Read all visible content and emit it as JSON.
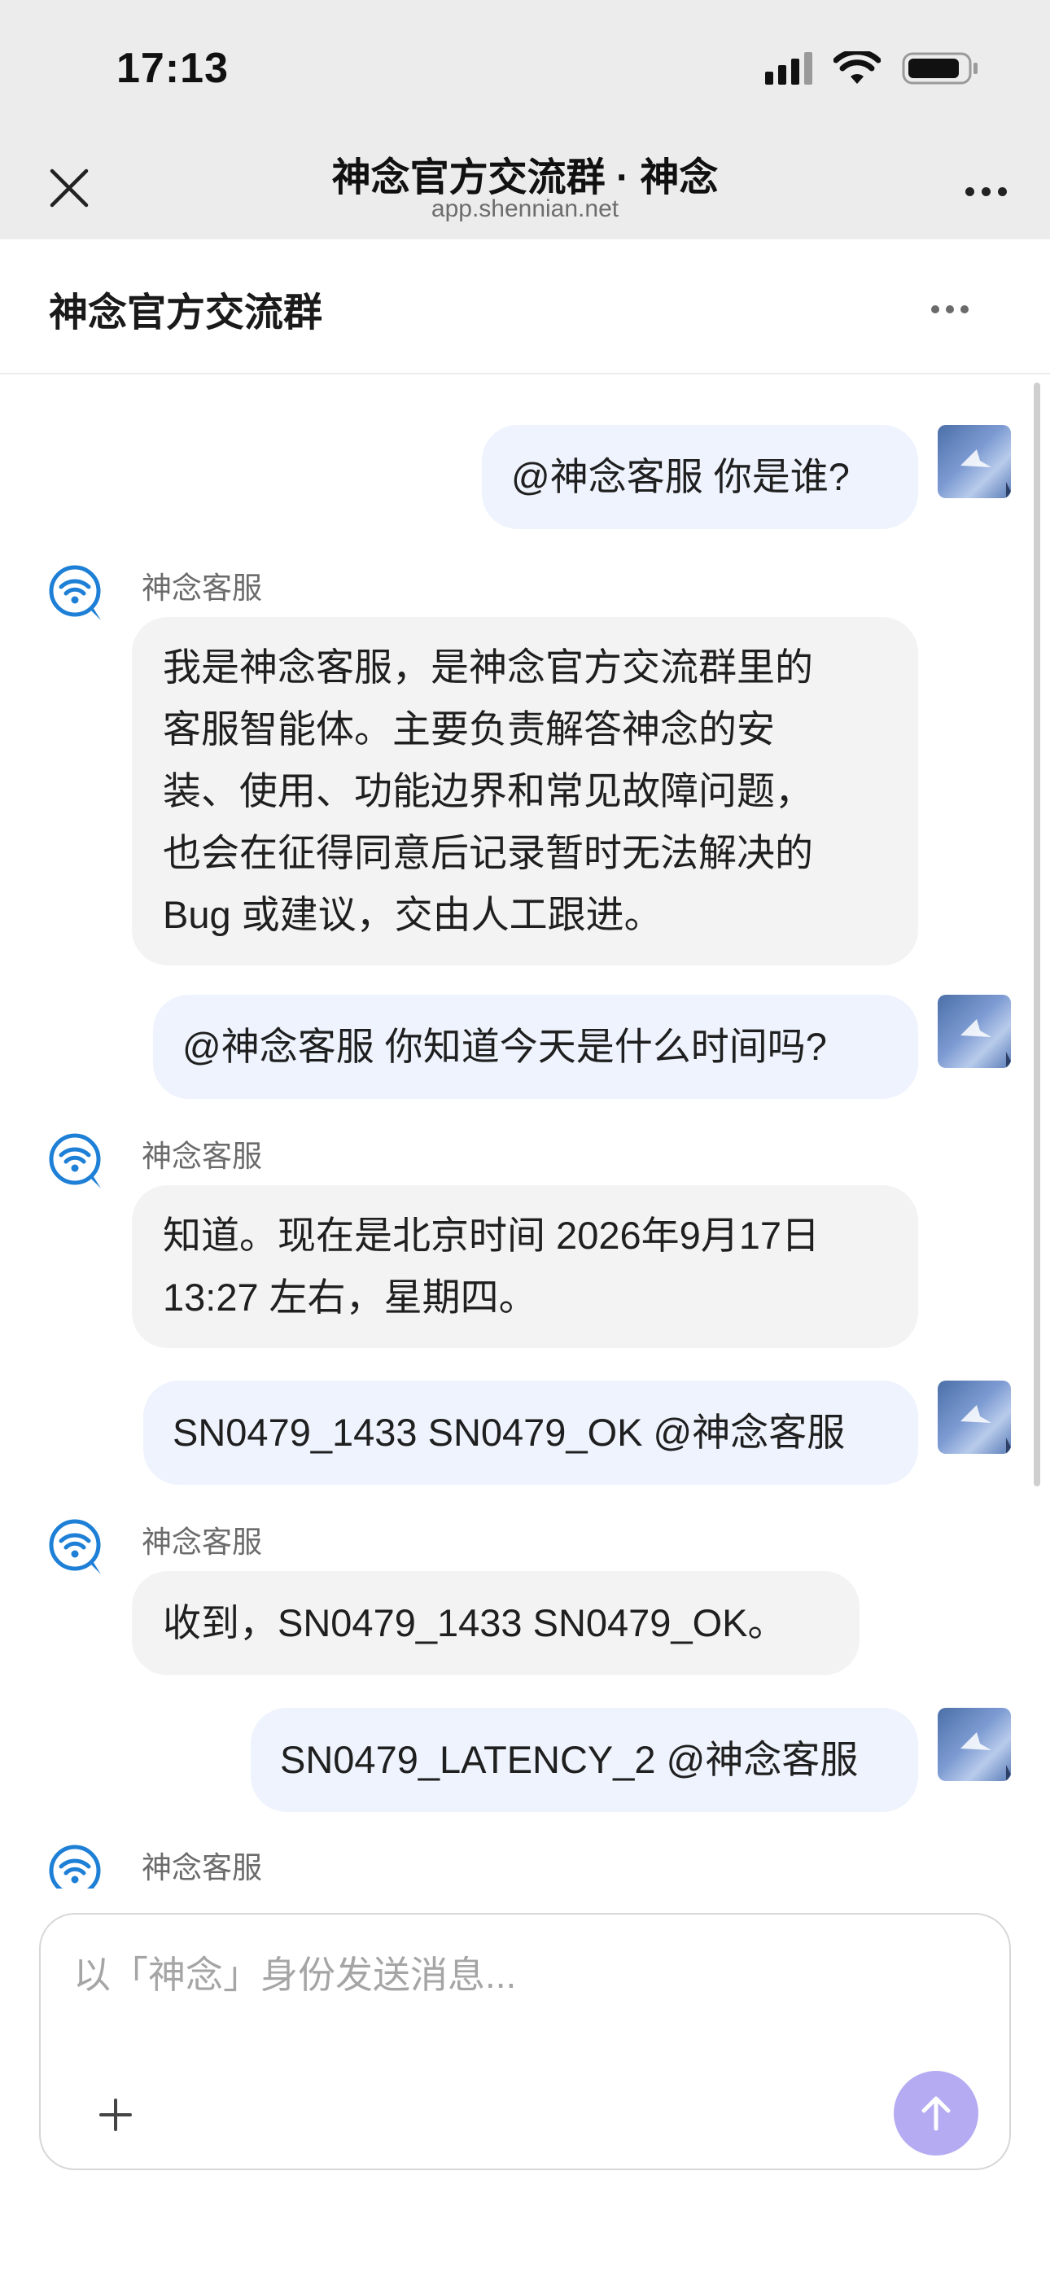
{
  "status_bar": {
    "time": "17:13"
  },
  "browser": {
    "title": "神念官方交流群 · 神念",
    "url": "app.shennian.net"
  },
  "chat": {
    "title": "神念官方交流群"
  },
  "messages": [
    {
      "role": "user",
      "text": "@神念客服 你是谁?"
    },
    {
      "role": "bot",
      "name": "神念客服",
      "lines": [
        "我是神念客服，是神念官方交流群里的",
        "客服智能体。主要负责解答神念的安",
        "装、使用、功能边界和常见故障问题，",
        "也会在征得同意后记录暂时无法解决的",
        "Bug 或建议，交由人工跟进。"
      ]
    },
    {
      "role": "user",
      "text": "@神念客服 你知道今天是什么时间吗?"
    },
    {
      "role": "bot",
      "name": "神念客服",
      "lines": [
        "知道。现在是北京时间 2026年9月17日",
        "13:27 左右，星期四。"
      ]
    },
    {
      "role": "user",
      "text": "SN0479_1433 SN0479_OK @神念客服"
    },
    {
      "role": "bot",
      "name": "神念客服",
      "lines": [
        "收到，SN0479_1433 SN0479_OK。"
      ]
    },
    {
      "role": "user",
      "text": "SN0479_LATENCY_2 @神念客服"
    },
    {
      "role": "bot",
      "name": "神念客服",
      "lines": []
    }
  ],
  "composer": {
    "placeholder": "以「神念」身份发送消息..."
  },
  "icons": {
    "close": "close-icon",
    "more": "more-horizontal-icon",
    "bot": "signal-chat-icon",
    "add": "plus-icon",
    "send": "arrow-up-icon"
  },
  "colors": {
    "user_bubble": "#eef3fd",
    "bot_bubble": "#f3f3f3",
    "bot_icon": "#1d7fd6",
    "send_button": "#b4abf3"
  }
}
